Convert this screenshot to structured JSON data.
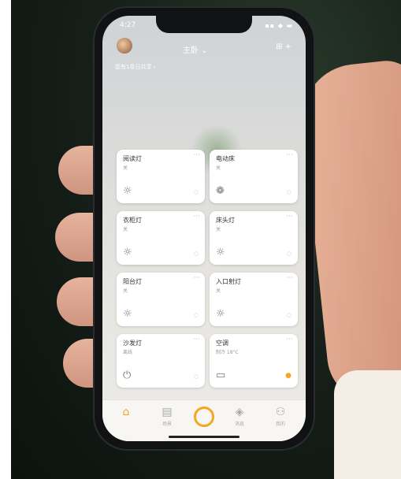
{
  "status": {
    "time": "4:27",
    "indicators": "▪▪ ◆ ▬"
  },
  "header": {
    "room": "主卧 ⌄",
    "subtitle": "您有1条日共享 ›",
    "icons": "⊞  +"
  },
  "cards": [
    {
      "name": "阅读灯",
      "state": "关",
      "icon": "☼",
      "toggle": "○",
      "on": false
    },
    {
      "name": "电动床",
      "state": "关",
      "icon": "❁",
      "toggle": "○",
      "on": false
    },
    {
      "name": "衣柜灯",
      "state": "关",
      "icon": "☼",
      "toggle": "○",
      "on": false
    },
    {
      "name": "床头灯",
      "state": "关",
      "icon": "☼",
      "toggle": "○",
      "on": false
    },
    {
      "name": "阳台灯",
      "state": "关",
      "icon": "☼",
      "toggle": "○",
      "on": false
    },
    {
      "name": "入口射灯",
      "state": "关",
      "icon": "☼",
      "toggle": "○",
      "on": false
    },
    {
      "name": "沙发灯",
      "state": "离线",
      "icon": "⏻",
      "toggle": "○",
      "on": false
    },
    {
      "name": "空调",
      "state": "制冷 18°C",
      "icon": "▭",
      "toggle": "●",
      "on": true
    }
  ],
  "tabs": [
    {
      "icon": "⌂",
      "label": ""
    },
    {
      "icon": "▤",
      "label": "场景"
    },
    {
      "icon": "",
      "label": ""
    },
    {
      "icon": "◈",
      "label": "消息"
    },
    {
      "icon": "⚇",
      "label": "我的"
    }
  ],
  "colors": {
    "accent": "#f5a623"
  }
}
